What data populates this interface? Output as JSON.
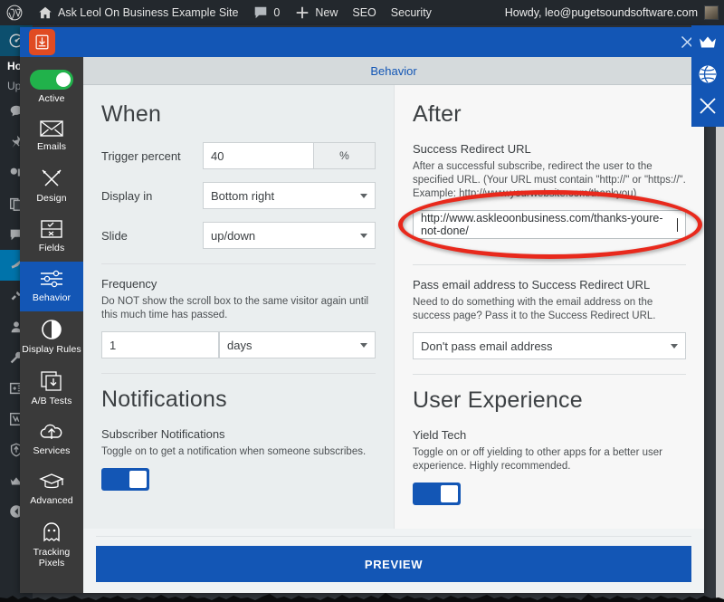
{
  "wp_adminbar": {
    "logo_icon": "wordpress-icon",
    "site_icon": "home-icon",
    "site_name": "Ask Leol On Business Example Site",
    "comments_icon": "comment-icon",
    "comments_count": "0",
    "new_icon": "plus-icon",
    "new_label": "New",
    "seo_label": "SEO",
    "security_label": "Security",
    "howdy": "Howdy, leo@pugetsoundsoftware.com",
    "avatar_icon": "avatar"
  },
  "wp_sidebar": {
    "items": [
      {
        "icon": "dashboard-icon",
        "label": ""
      },
      {
        "icon": "",
        "label": "Ho"
      },
      {
        "icon": "",
        "label": "Up"
      },
      {
        "icon": "chat-icon",
        "label": ""
      },
      {
        "icon": "pin-icon",
        "label": ""
      },
      {
        "icon": "media-icon",
        "label": ""
      },
      {
        "icon": "pages-icon",
        "label": ""
      },
      {
        "icon": "comments-icon",
        "label": ""
      },
      {
        "icon": "appearance-icon",
        "label": ""
      },
      {
        "icon": "plugins-icon",
        "label": ""
      },
      {
        "icon": "users-icon",
        "label": ""
      },
      {
        "icon": "tools-icon",
        "label": ""
      },
      {
        "icon": "settings-icon",
        "label": ""
      },
      {
        "icon": "yoast-icon",
        "label": ""
      },
      {
        "icon": "shield-icon",
        "label": ""
      },
      {
        "icon": "crown-icon",
        "label": ""
      },
      {
        "icon": "collapse-icon",
        "label": ""
      }
    ]
  },
  "right_rail": {
    "items": [
      {
        "icon": "crown-icon"
      },
      {
        "icon": "globe-icon"
      },
      {
        "icon": "close-x-icon"
      }
    ]
  },
  "modal": {
    "brand_icon": "scrollbox-download-icon",
    "close_icon": "close-icon",
    "tab_label": "Behavior"
  },
  "plugin_nav": {
    "toggle_state": "on",
    "items": [
      {
        "icon": "toggle-switch",
        "label": "Active",
        "selected": false
      },
      {
        "icon": "envelope-icon",
        "label": "Emails",
        "selected": false
      },
      {
        "icon": "pencils-icon",
        "label": "Design",
        "selected": false
      },
      {
        "icon": "form-fields-icon",
        "label": "Fields",
        "selected": false
      },
      {
        "icon": "sliders-icon",
        "label": "Behavior",
        "selected": true
      },
      {
        "icon": "contrast-circle-icon",
        "label": "Display Rules",
        "selected": false
      },
      {
        "icon": "ab-test-icon",
        "label": "A/B Tests",
        "selected": false
      },
      {
        "icon": "cloud-upload-icon",
        "label": "Services",
        "selected": false
      },
      {
        "icon": "graduation-cap-icon",
        "label": "Advanced",
        "selected": false
      },
      {
        "icon": "ghost-icon",
        "label": "Tracking Pixels",
        "selected": false
      }
    ]
  },
  "when": {
    "title": "When",
    "trigger_percent_label": "Trigger percent",
    "trigger_percent_value": "40",
    "trigger_percent_unit": "%",
    "display_in_label": "Display in",
    "display_in_value": "Bottom right",
    "slide_label": "Slide",
    "slide_value": "up/down",
    "frequency_heading": "Frequency",
    "frequency_help": "Do NOT show the scroll box to the same visitor again until this much time has passed.",
    "frequency_value": "1",
    "frequency_unit": "days"
  },
  "notifications": {
    "title": "Notifications",
    "sub_head": "Subscriber Notifications",
    "help": "Toggle on to get a notification when someone subscribes.",
    "toggle_state": "on"
  },
  "after": {
    "title": "After",
    "success_url_heading": "Success Redirect URL",
    "success_url_help": "After a successful subscribe, redirect the user to the specified URL. (Your URL must contain \"http://\" or \"https://\". Example: http://www.yourwebsite.com/thankyou)",
    "success_url_value": "http://www.askleoonbusiness.com/thanks-youre-not-done/",
    "pass_email_heading": "Pass email address to Success Redirect URL",
    "pass_email_help": "Need to do something with the email address on the success page? Pass it to the Success Redirect URL.",
    "pass_email_value": "Don't pass email address",
    "highlight_color": "#e8291c"
  },
  "user_experience": {
    "title": "User Experience",
    "sub_head": "Yield Tech",
    "help": "Toggle on or off yielding to other apps for a better user experience. Highly recommended.",
    "toggle_state": "on"
  },
  "footer": {
    "preview_label": "PREVIEW"
  },
  "colors": {
    "wp_bar": "#23282d",
    "brand_blue": "#1356b5",
    "brand_orange": "#e04b22",
    "toggle_green": "#21b24b",
    "highlight_red": "#e8291c"
  }
}
